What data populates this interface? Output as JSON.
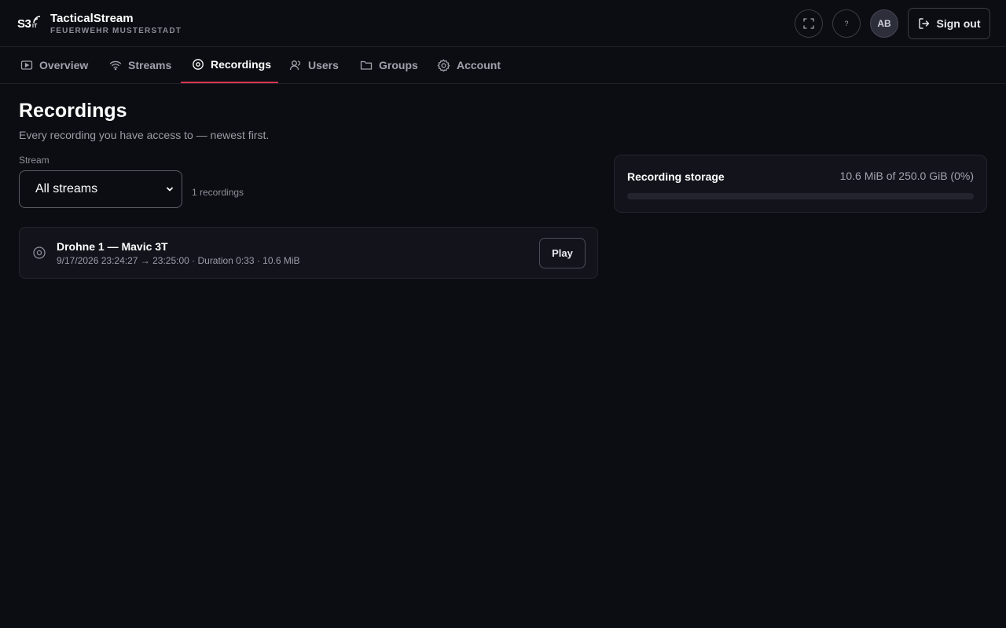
{
  "brand": {
    "logo_text": "S3",
    "logo_sub": "IT",
    "title": "TacticalStream",
    "subtitle": "FEUERWEHR MUSTERSTADT"
  },
  "header": {
    "avatar_initials": "AB",
    "sign_out_label": "Sign out",
    "help_glyph": "?"
  },
  "nav": {
    "tabs": [
      {
        "label": "Overview",
        "icon": "play-icon",
        "active": false
      },
      {
        "label": "Streams",
        "icon": "wifi-icon",
        "active": false
      },
      {
        "label": "Recordings",
        "icon": "record-icon",
        "active": true
      },
      {
        "label": "Users",
        "icon": "user-icon",
        "active": false
      },
      {
        "label": "Groups",
        "icon": "folder-icon",
        "active": false
      },
      {
        "label": "Account",
        "icon": "gear-icon",
        "active": false
      }
    ]
  },
  "main": {
    "title": "Recordings",
    "subtitle": "Every recording you have access to — newest first.",
    "filter": {
      "label": "Stream",
      "selected": "All streams"
    },
    "count_text": "1 recordings",
    "recordings": [
      {
        "title": "Drohne 1 — Mavic 3T",
        "meta": "9/17/2026 23:24:27 → 23:25:00 · Duration 0:33 · 10.6 MiB",
        "play_label": "Play"
      }
    ]
  },
  "storage": {
    "title": "Recording storage",
    "value_text": "10.6 MiB of 250.0 GiB (0%)",
    "used_fraction": 0.0
  },
  "colors": {
    "accent": "#d93651",
    "background": "#0c0d12",
    "card": "#13141b"
  }
}
